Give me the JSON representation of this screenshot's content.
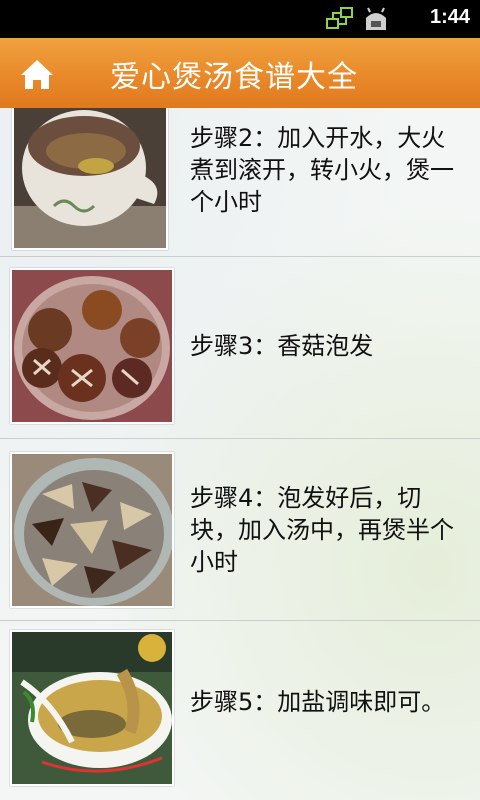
{
  "status_bar": {
    "time": "1:44",
    "icons": [
      "sync-icon",
      "usb-debug-icon"
    ]
  },
  "header": {
    "title": "爱心煲汤食谱大全",
    "home_icon": "home-icon",
    "color": "#e9892a"
  },
  "steps": [
    {
      "text": "步骤2：加入开水，大火煮到滚开，转小火，煲一个小时",
      "image": "clay-pot-soup-image"
    },
    {
      "text": "步骤3：香菇泡发",
      "image": "shiitake-in-water-image"
    },
    {
      "text": "步骤4：泡发好后，切块，加入汤中，再煲半个小时",
      "image": "sliced-mushrooms-image"
    },
    {
      "text": "步骤5：加盐调味即可。",
      "image": "finished-soup-bowl-image"
    }
  ]
}
